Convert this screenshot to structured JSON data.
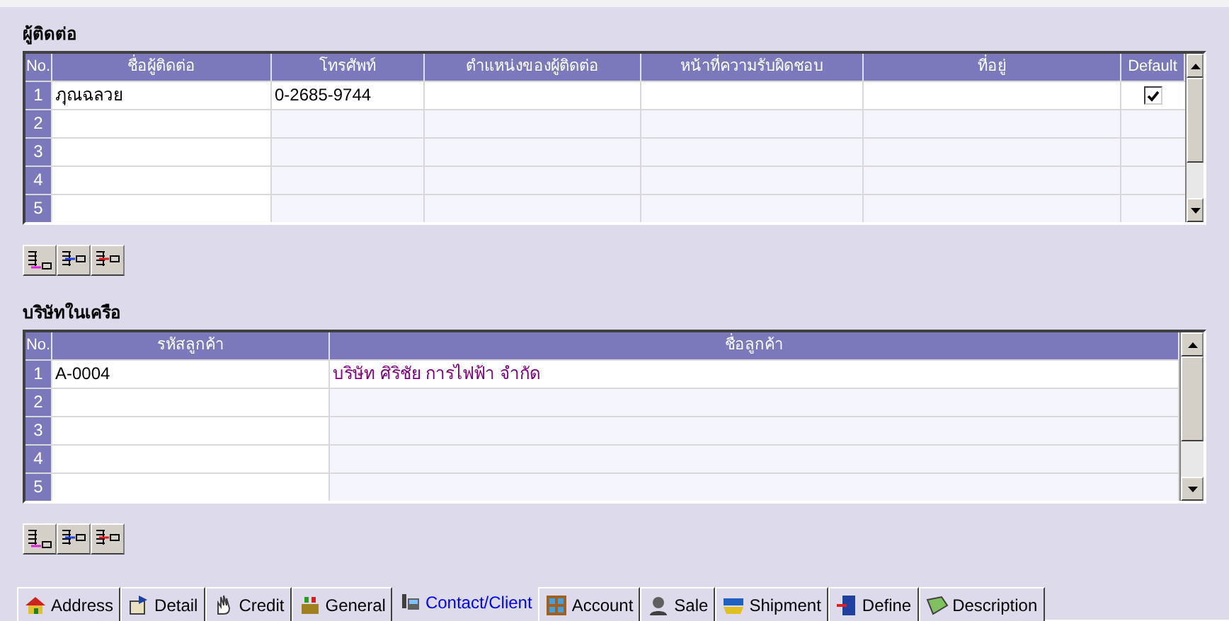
{
  "contacts": {
    "title": "ผู้ติดต่อ",
    "columns": [
      "No.",
      "ชื่อผู้ติดต่อ",
      "โทรศัพท์",
      "ตำแหน่งของผู้ติดต่อ",
      "หน้าที่ความรับผิดชอบ",
      "ที่อยู่",
      "Default"
    ],
    "rows": [
      {
        "cells": [
          "1",
          "ฦุณฉลวย",
          "0-2685-9744",
          "",
          "",
          ""
        ],
        "default": true
      },
      {
        "cells": [
          "2",
          "",
          "",
          "",
          "",
          ""
        ],
        "default": false
      },
      {
        "cells": [
          "3",
          "",
          "",
          "",
          "",
          ""
        ],
        "default": false
      },
      {
        "cells": [
          "4",
          "",
          "",
          "",
          "",
          ""
        ],
        "default": false
      },
      {
        "cells": [
          "5",
          "",
          "",
          "",
          "",
          ""
        ],
        "default": false
      }
    ]
  },
  "affiliates": {
    "title": "บริษัทในเครือ",
    "columns": [
      "No.",
      "รหัสลูกค้า",
      "ชื่อลูกค้า"
    ],
    "rows": [
      {
        "cells": [
          "1",
          "A-0004",
          "บริษัท ศิริชัย การไฟฟ้า จำกัด"
        ]
      },
      {
        "cells": [
          "2",
          "",
          ""
        ]
      },
      {
        "cells": [
          "3",
          "",
          ""
        ]
      },
      {
        "cells": [
          "4",
          "",
          ""
        ]
      },
      {
        "cells": [
          "5",
          "",
          ""
        ]
      }
    ]
  },
  "tabs": [
    {
      "label": "Address",
      "kind": "house",
      "selected": false
    },
    {
      "label": "Detail",
      "kind": "detail",
      "selected": false
    },
    {
      "label": "Credit",
      "kind": "hand",
      "selected": false
    },
    {
      "label": "General",
      "kind": "box",
      "selected": false
    },
    {
      "label": "Contact/Client",
      "kind": "phone",
      "selected": true
    },
    {
      "label": "Account",
      "kind": "grid",
      "selected": false
    },
    {
      "label": "Sale",
      "kind": "person",
      "selected": false
    },
    {
      "label": "Shipment",
      "kind": "ship",
      "selected": false
    },
    {
      "label": "Define",
      "kind": "list",
      "selected": false
    },
    {
      "label": "Description",
      "kind": "tag",
      "selected": false
    }
  ]
}
